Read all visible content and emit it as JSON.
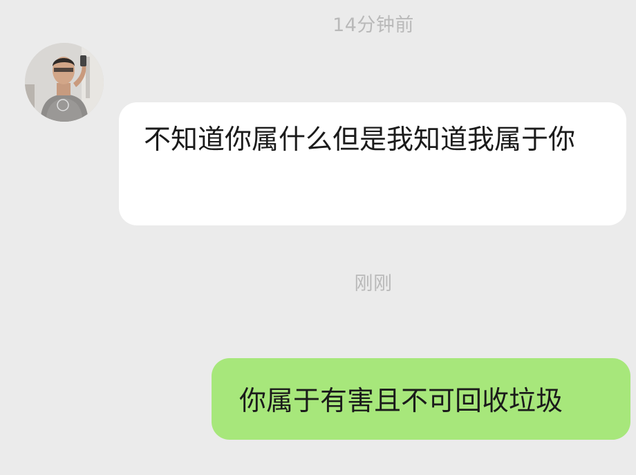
{
  "messages": {
    "time_1": "14分钟前",
    "incoming_text": "不知道你属什么但是我知道我属于你",
    "time_2": "刚刚",
    "outgoing_text": "你属于有害且不可回收垃圾"
  },
  "colors": {
    "background": "#ebebeb",
    "incoming_bubble": "#ffffff",
    "outgoing_bubble": "#a7e77b",
    "timestamp_text": "#b9b9b9"
  },
  "icons": {
    "avatar": "user-avatar-photo"
  }
}
